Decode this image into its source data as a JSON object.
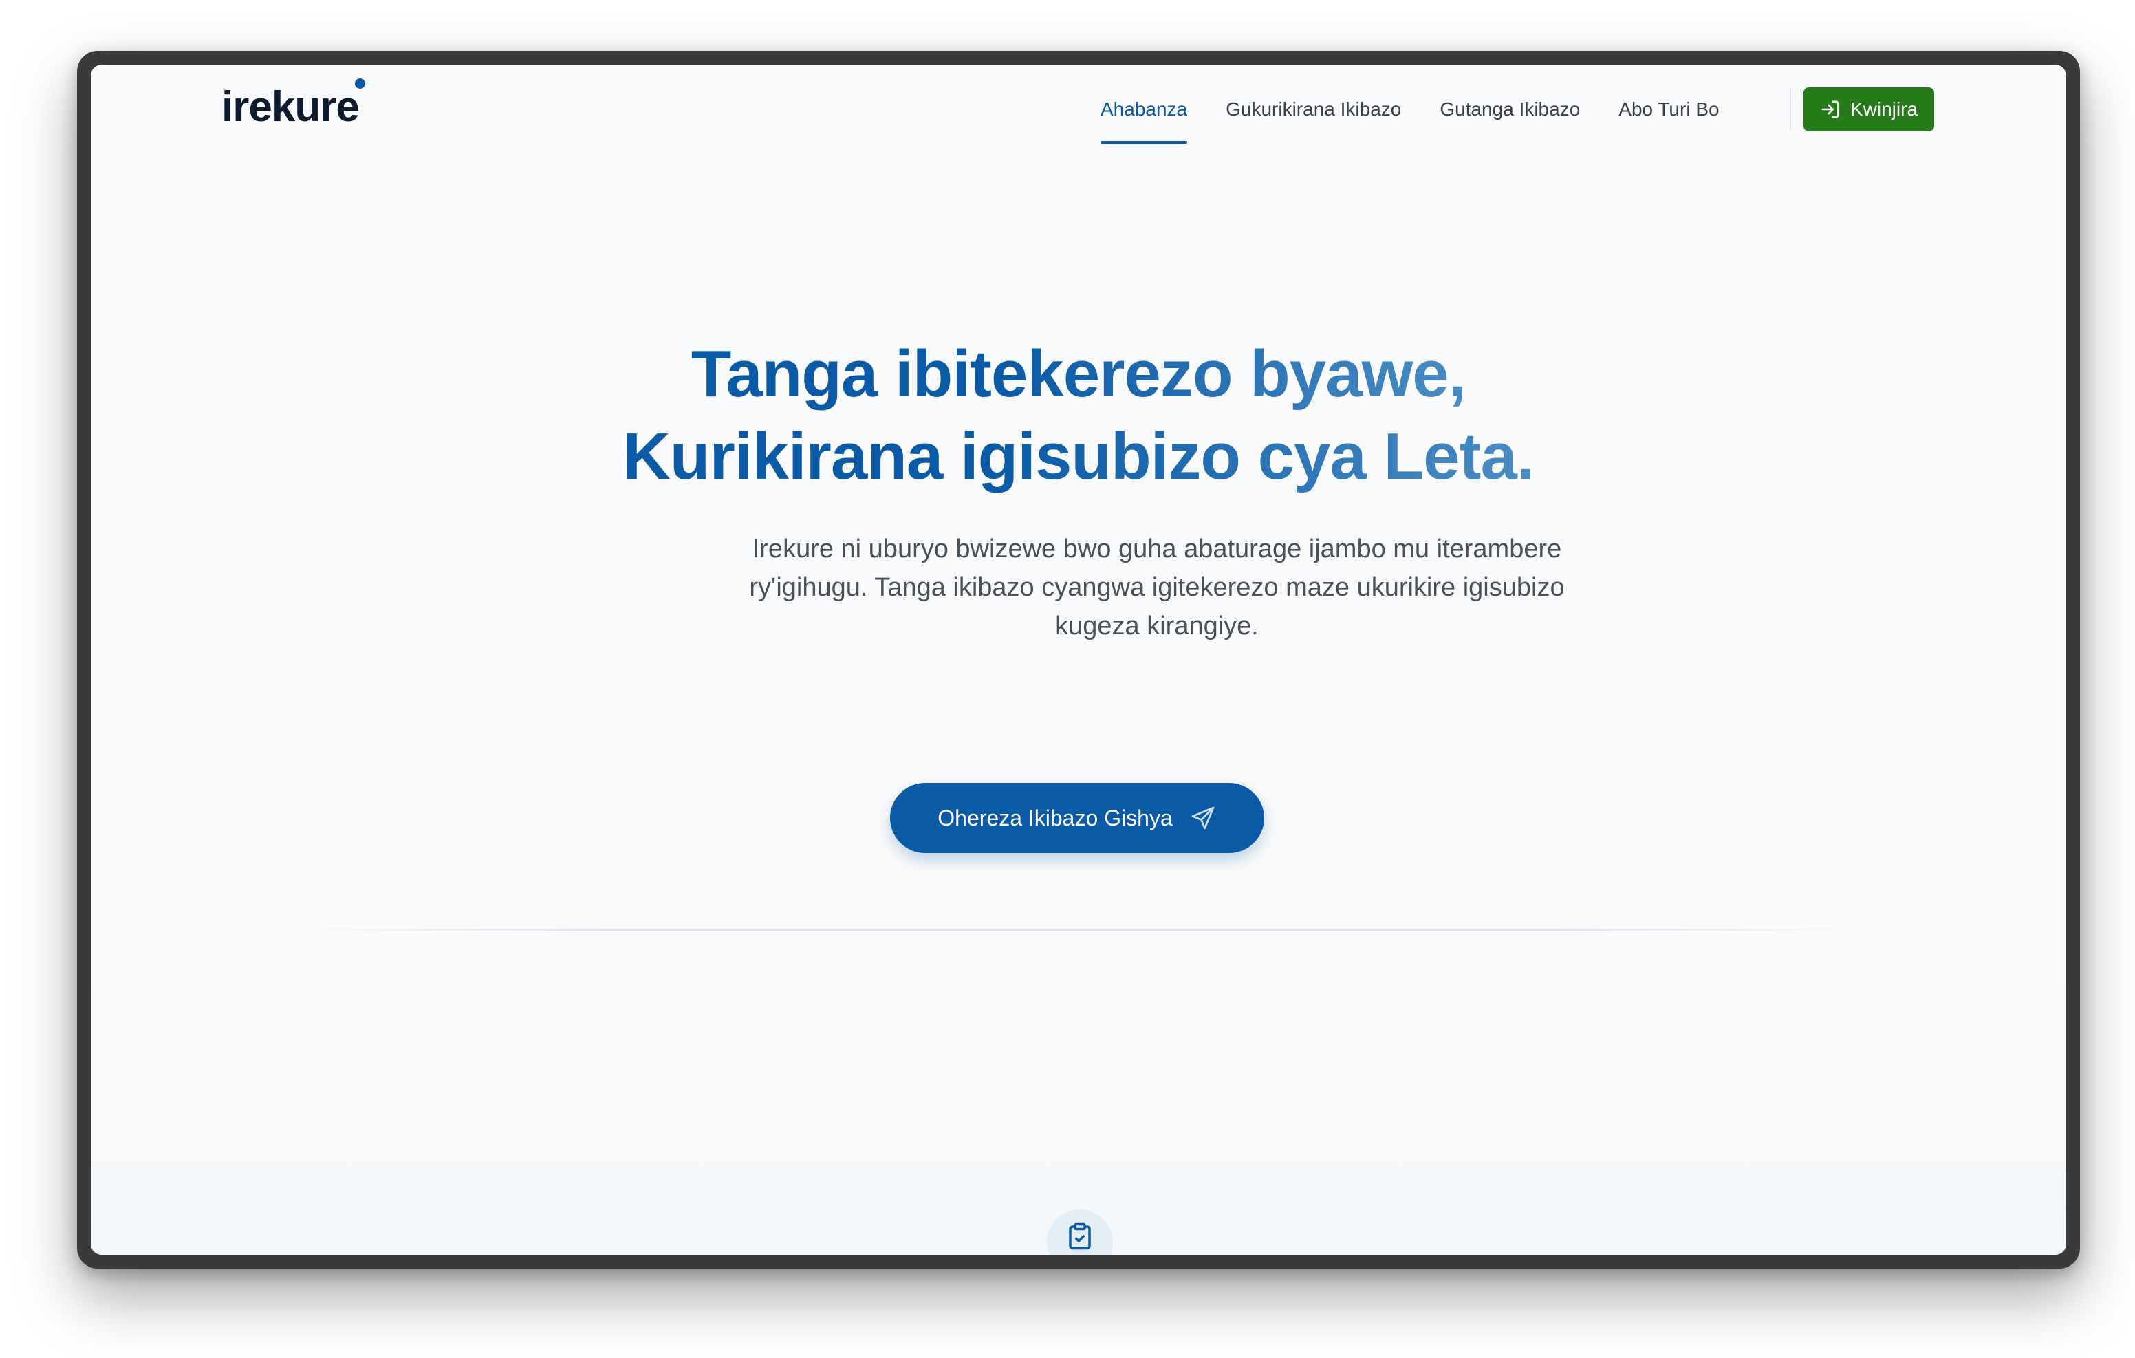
{
  "brand": {
    "name": "irekure"
  },
  "nav": {
    "items": [
      {
        "label": "Ahabanza",
        "active": true
      },
      {
        "label": "Gukurikirana Ikibazo",
        "active": false
      },
      {
        "label": "Gutanga Ikibazo",
        "active": false
      },
      {
        "label": "Abo Turi Bo",
        "active": false
      }
    ],
    "login_label": "Kwinjira",
    "login_icon": "login-icon"
  },
  "hero": {
    "title_line1": "Tanga ibitekerezo byawe,",
    "title_line2": "Kurikirana igisubizo cya Leta.",
    "subtitle": "Irekure ni uburyo bwizewe bwo guha abaturage ijambo mu iterambere ry'igihugu. Tanga ikibazo cyangwa igitekerezo maze ukurikire igisubizo kugeza kirangiye.",
    "cta_label": "Ohereza Ikibazo Gishya",
    "cta_icon": "send-icon"
  },
  "feature": {
    "icon": "clipboard-check-icon"
  },
  "colors": {
    "primary": "#0a5aa5",
    "login_green": "#277a1a",
    "text_dark": "#0d1b2e",
    "text_muted": "#4b5058"
  }
}
